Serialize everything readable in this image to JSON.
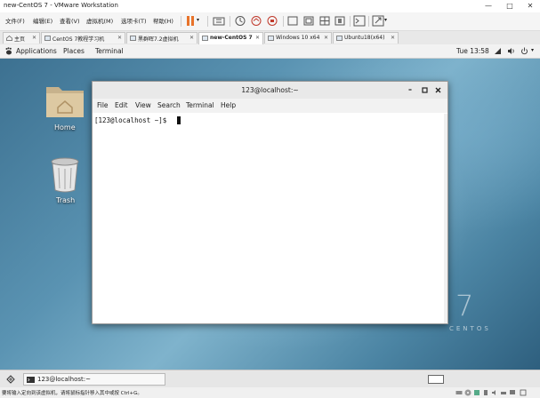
{
  "window": {
    "title": "new-CentOS 7 - VMware Workstation",
    "controls": {
      "minimize": "—",
      "maximize": "□",
      "close": "✕"
    }
  },
  "vm_menu": [
    "文件(F)",
    "编辑(E)",
    "查看(V)",
    "虚拟机(M)",
    "选项卡(T)",
    "帮助(H)"
  ],
  "vm_tabs": [
    {
      "label": "主页",
      "active": false
    },
    {
      "label": "CentOS 7教程学习机",
      "active": false
    },
    {
      "label": "黑群晖7.2虚拟机",
      "active": false
    },
    {
      "label": "new-CentOS 7",
      "active": true
    },
    {
      "label": "Windows 10 x64",
      "active": false
    },
    {
      "label": "Ubuntu18(x64)",
      "active": false
    }
  ],
  "gnome": {
    "applications": "Applications",
    "places": "Places",
    "terminal": "Terminal",
    "clock": "Tue 13:58"
  },
  "desktop": {
    "home_label": "Home",
    "trash_label": "Trash"
  },
  "terminal": {
    "title": "123@localhost:~",
    "menu": [
      "File",
      "Edit",
      "View",
      "Search",
      "Terminal",
      "Help"
    ],
    "prompt": "[123@localhost ~]$ "
  },
  "centos_logo": {
    "number": "7",
    "text": "CENTOS"
  },
  "taskbar": {
    "item_label": "123@localhost:~"
  },
  "statusbar": {
    "text": "要将输入定向到该虚拟机，请将鼠标指针移入其中或按 Ctrl+G。"
  },
  "colors": {
    "pause_icon": "#e8732a",
    "desktop_blue": "#4b84a3"
  }
}
